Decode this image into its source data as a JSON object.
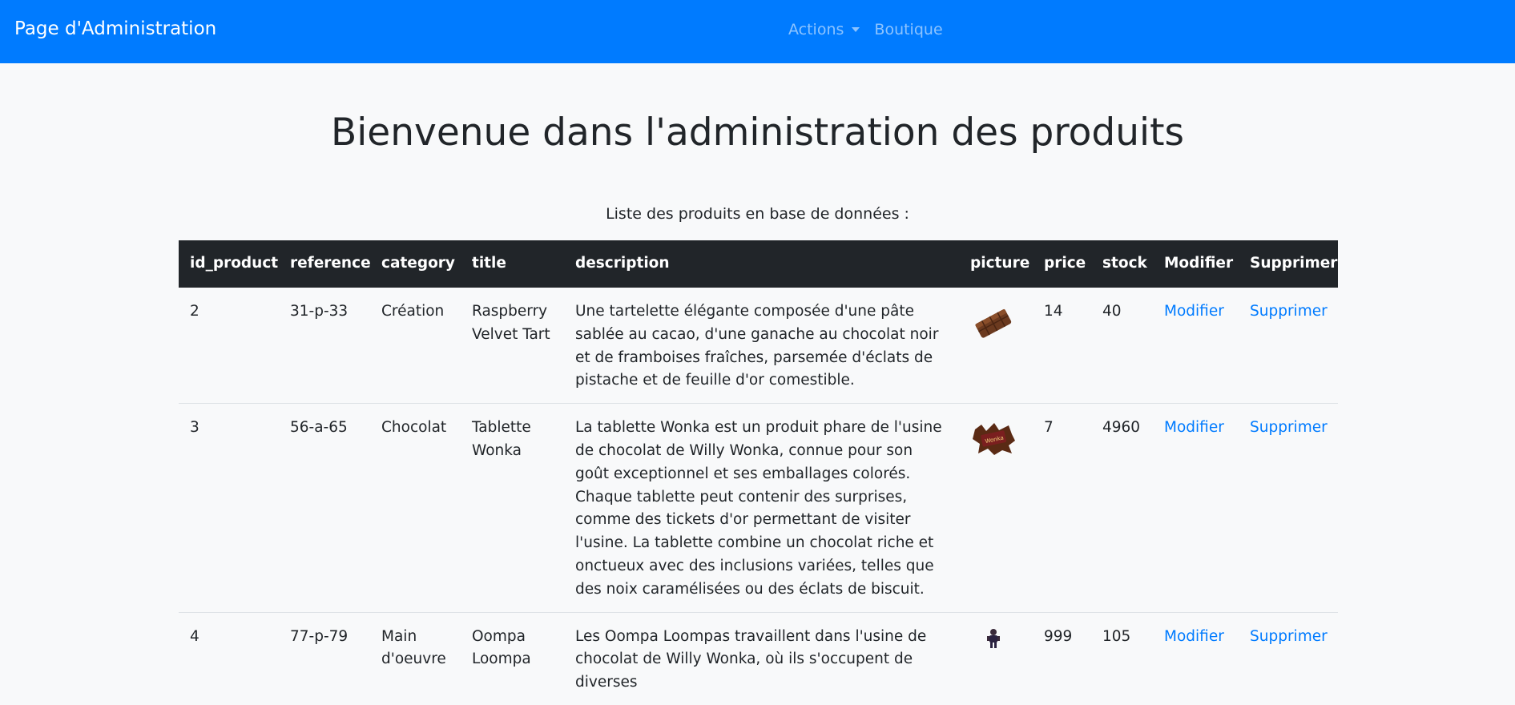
{
  "navbar": {
    "brand": "Page d'Administration",
    "actions_label": "Actions",
    "shop_label": "Boutique"
  },
  "page": {
    "title": "Bienvenue dans l'administration des produits",
    "subtitle": "Liste des produits en base de données :"
  },
  "table": {
    "headers": {
      "id_product": "id_product",
      "reference": "reference",
      "category": "category",
      "title": "title",
      "description": "description",
      "picture": "picture",
      "price": "price",
      "stock": "stock",
      "modify": "Modifier",
      "delete": "Supprimer"
    },
    "rows": [
      {
        "id_product": "2",
        "reference": "31-p-33",
        "category": "Création",
        "title": "Raspberry Velvet Tart",
        "description": "Une tartelette élégante composée d'une pâte sablée au cacao, d'une ganache au chocolat noir et de framboises fraîches, parsemée d'éclats de pistache et de feuille d'or comestible.",
        "picture": "chocolate-bar-icon",
        "price": "14",
        "stock": "40",
        "modify_label": "Modifier",
        "delete_label": "Supprimer"
      },
      {
        "id_product": "3",
        "reference": "56-a-65",
        "category": "Chocolat",
        "title": "Tablette Wonka",
        "description": "La tablette Wonka est un produit phare de l'usine de chocolat de Willy Wonka, connue pour son goût exceptionnel et ses emballages colorés. Chaque tablette peut contenir des surprises, comme des tickets d'or permettant de visiter l'usine. La tablette combine un chocolat riche et onctueux avec des inclusions variées, telles que des noix caramélisées ou des éclats de biscuit.",
        "picture": "wonka-bar-icon",
        "price": "7",
        "stock": "4960",
        "modify_label": "Modifier",
        "delete_label": "Supprimer"
      },
      {
        "id_product": "4",
        "reference": "77-p-79",
        "category": "Main d'oeuvre",
        "title": "Oompa Loompa",
        "description": "Les Oompa Loompas travaillent dans l'usine de chocolat de Willy Wonka, où ils s'occupent de diverses",
        "picture": "oompa-loompa-icon",
        "price": "999",
        "stock": "105",
        "modify_label": "Modifier",
        "delete_label": "Supprimer"
      }
    ]
  }
}
